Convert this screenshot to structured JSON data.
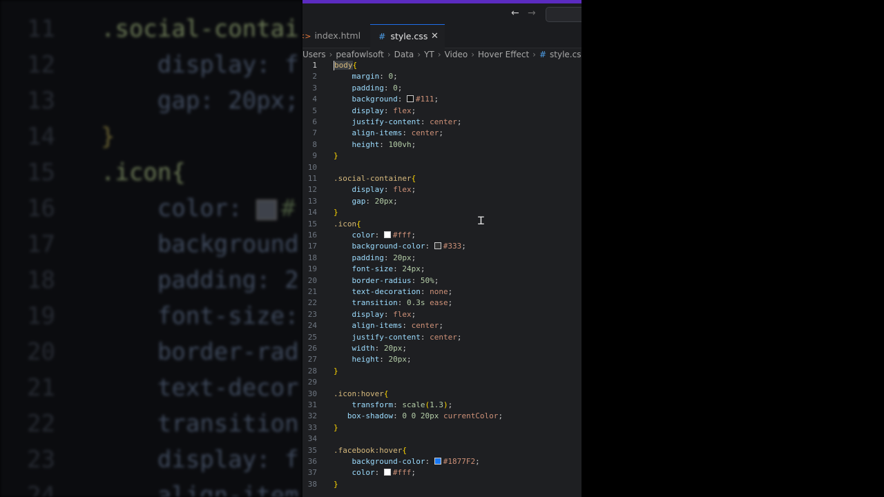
{
  "background": {
    "lines": [
      {
        "num": "11",
        "parts": [
          {
            "t": ".social-contai",
            "c": "bg-sel"
          }
        ]
      },
      {
        "num": "12",
        "parts": [
          {
            "t": "    display: f",
            "c": "bg-prop"
          }
        ]
      },
      {
        "num": "13",
        "parts": [
          {
            "t": "    gap: 20px;",
            "c": "bg-prop"
          }
        ]
      },
      {
        "num": "14",
        "parts": [
          {
            "t": "}",
            "c": "bg-brace"
          }
        ]
      },
      {
        "num": "15",
        "parts": [
          {
            "t": ".icon{",
            "c": "bg-sel"
          }
        ]
      },
      {
        "num": "16",
        "parts": [
          {
            "t": "    color: ",
            "c": "bg-prop"
          },
          {
            "t": "SWATCH",
            "c": ""
          },
          {
            "t": "#",
            "c": "bg-val"
          }
        ]
      },
      {
        "num": "17",
        "parts": [
          {
            "t": "    background-",
            "c": "bg-prop"
          }
        ]
      },
      {
        "num": "18",
        "parts": [
          {
            "t": "    padding: 2",
            "c": "bg-prop"
          }
        ]
      },
      {
        "num": "19",
        "parts": [
          {
            "t": "    font-size:",
            "c": "bg-prop"
          }
        ]
      },
      {
        "num": "20",
        "parts": [
          {
            "t": "    border-rad",
            "c": "bg-prop"
          }
        ]
      },
      {
        "num": "21",
        "parts": [
          {
            "t": "    text-decor",
            "c": "bg-prop"
          }
        ]
      },
      {
        "num": "22",
        "parts": [
          {
            "t": "    transition",
            "c": "bg-prop"
          }
        ]
      },
      {
        "num": "23",
        "parts": [
          {
            "t": "    display: f",
            "c": "bg-prop"
          }
        ]
      },
      {
        "num": "24",
        "parts": [
          {
            "t": "    align-item",
            "c": "bg-prop"
          }
        ]
      }
    ]
  },
  "tabs": {
    "index": {
      "label": "index.html",
      "icon": "<>"
    },
    "style": {
      "label": "style.css",
      "icon": "#",
      "close": "✕"
    }
  },
  "nav": {
    "back": "←",
    "forward": "→"
  },
  "breadcrumb": [
    "Users",
    "peafowlsoft",
    "Data",
    "YT",
    "Video",
    "Hover Effect",
    "style.css"
  ],
  "breadcrumb_sep": "›",
  "code": [
    {
      "n": "1",
      "t": [
        [
          "body",
          "sel hl"
        ],
        [
          "{",
          "br"
        ]
      ]
    },
    {
      "n": "2",
      "t": [
        [
          "    margin",
          "prop"
        ],
        [
          ": ",
          "pun"
        ],
        [
          "0",
          "num"
        ],
        [
          ";",
          "pun"
        ]
      ]
    },
    {
      "n": "3",
      "t": [
        [
          "    padding",
          "prop"
        ],
        [
          ": ",
          "pun"
        ],
        [
          "0",
          "num"
        ],
        [
          ";",
          "pun"
        ]
      ]
    },
    {
      "n": "4",
      "t": [
        [
          "    background",
          "prop"
        ],
        [
          ": ",
          "pun"
        ],
        [
          "",
          "sw:#111111"
        ],
        [
          "#111",
          "str"
        ],
        [
          ";",
          "pun"
        ]
      ]
    },
    {
      "n": "5",
      "t": [
        [
          "    display",
          "prop"
        ],
        [
          ": ",
          "pun"
        ],
        [
          "flex",
          "str"
        ],
        [
          ";",
          "pun"
        ]
      ]
    },
    {
      "n": "6",
      "t": [
        [
          "    justify-content",
          "prop"
        ],
        [
          ": ",
          "pun"
        ],
        [
          "center",
          "str"
        ],
        [
          ";",
          "pun"
        ]
      ]
    },
    {
      "n": "7",
      "t": [
        [
          "    align-items",
          "prop"
        ],
        [
          ": ",
          "pun"
        ],
        [
          "center",
          "str"
        ],
        [
          ";",
          "pun"
        ]
      ]
    },
    {
      "n": "8",
      "t": [
        [
          "    height",
          "prop"
        ],
        [
          ": ",
          "pun"
        ],
        [
          "100vh",
          "num"
        ],
        [
          ";",
          "pun"
        ]
      ]
    },
    {
      "n": "9",
      "t": [
        [
          "}",
          "br"
        ]
      ]
    },
    {
      "n": "10",
      "t": []
    },
    {
      "n": "11",
      "t": [
        [
          ".social-container",
          "sel"
        ],
        [
          "{",
          "br"
        ]
      ]
    },
    {
      "n": "12",
      "t": [
        [
          "    display",
          "prop"
        ],
        [
          ": ",
          "pun"
        ],
        [
          "flex",
          "str"
        ],
        [
          ";",
          "pun"
        ]
      ]
    },
    {
      "n": "13",
      "t": [
        [
          "    gap",
          "prop"
        ],
        [
          ": ",
          "pun"
        ],
        [
          "20px",
          "num"
        ],
        [
          ";",
          "pun"
        ]
      ]
    },
    {
      "n": "14",
      "t": [
        [
          "}",
          "br"
        ]
      ]
    },
    {
      "n": "15",
      "t": [
        [
          ".icon",
          "sel"
        ],
        [
          "{",
          "br"
        ]
      ]
    },
    {
      "n": "16",
      "t": [
        [
          "    color",
          "prop"
        ],
        [
          ": ",
          "pun"
        ],
        [
          "",
          "sw:#ffffff"
        ],
        [
          "#fff",
          "str"
        ],
        [
          ";",
          "pun"
        ]
      ]
    },
    {
      "n": "17",
      "t": [
        [
          "    background-color",
          "prop"
        ],
        [
          ": ",
          "pun"
        ],
        [
          "",
          "sw:#333333"
        ],
        [
          "#333",
          "str"
        ],
        [
          ";",
          "pun"
        ]
      ]
    },
    {
      "n": "18",
      "t": [
        [
          "    padding",
          "prop"
        ],
        [
          ": ",
          "pun"
        ],
        [
          "20px",
          "num"
        ],
        [
          ";",
          "pun"
        ]
      ]
    },
    {
      "n": "19",
      "t": [
        [
          "    font-size",
          "prop"
        ],
        [
          ": ",
          "pun"
        ],
        [
          "24px",
          "num"
        ],
        [
          ";",
          "pun"
        ]
      ]
    },
    {
      "n": "20",
      "t": [
        [
          "    border-radius",
          "prop"
        ],
        [
          ": ",
          "pun"
        ],
        [
          "50%",
          "num"
        ],
        [
          ";",
          "pun"
        ]
      ]
    },
    {
      "n": "21",
      "t": [
        [
          "    text-decoration",
          "prop"
        ],
        [
          ": ",
          "pun"
        ],
        [
          "none",
          "str"
        ],
        [
          ";",
          "pun"
        ]
      ]
    },
    {
      "n": "22",
      "t": [
        [
          "    transition",
          "prop"
        ],
        [
          ": ",
          "pun"
        ],
        [
          "0.3s",
          "num"
        ],
        [
          " ",
          "pun"
        ],
        [
          "ease",
          "str"
        ],
        [
          ";",
          "pun"
        ]
      ]
    },
    {
      "n": "23",
      "t": [
        [
          "    display",
          "prop"
        ],
        [
          ": ",
          "pun"
        ],
        [
          "flex",
          "str"
        ],
        [
          ";",
          "pun"
        ]
      ]
    },
    {
      "n": "24",
      "t": [
        [
          "    align-items",
          "prop"
        ],
        [
          ": ",
          "pun"
        ],
        [
          "center",
          "str"
        ],
        [
          ";",
          "pun"
        ]
      ]
    },
    {
      "n": "25",
      "t": [
        [
          "    justify-content",
          "prop"
        ],
        [
          ": ",
          "pun"
        ],
        [
          "center",
          "str"
        ],
        [
          ";",
          "pun"
        ]
      ]
    },
    {
      "n": "26",
      "t": [
        [
          "    width",
          "prop"
        ],
        [
          ": ",
          "pun"
        ],
        [
          "20px",
          "num"
        ],
        [
          ";",
          "pun"
        ]
      ]
    },
    {
      "n": "27",
      "t": [
        [
          "    height",
          "prop"
        ],
        [
          ": ",
          "pun"
        ],
        [
          "20px",
          "num"
        ],
        [
          ";",
          "pun"
        ]
      ]
    },
    {
      "n": "28",
      "t": [
        [
          "}",
          "br"
        ]
      ]
    },
    {
      "n": "29",
      "t": []
    },
    {
      "n": "30",
      "t": [
        [
          ".icon:hover",
          "sel"
        ],
        [
          "{",
          "br"
        ]
      ]
    },
    {
      "n": "31",
      "t": [
        [
          "    transform",
          "prop"
        ],
        [
          ": ",
          "pun"
        ],
        [
          "scale",
          "num"
        ],
        [
          "(",
          "br"
        ],
        [
          "1.3",
          "num"
        ],
        [
          ")",
          "br"
        ],
        [
          ";",
          "pun"
        ]
      ]
    },
    {
      "n": "32",
      "t": [
        [
          "   box-shadow",
          "prop"
        ],
        [
          ": ",
          "pun"
        ],
        [
          "0 0 20px",
          "num"
        ],
        [
          " ",
          "pun"
        ],
        [
          "currentColor",
          "str"
        ],
        [
          ";",
          "pun"
        ]
      ]
    },
    {
      "n": "33",
      "t": [
        [
          "}",
          "br"
        ]
      ]
    },
    {
      "n": "34",
      "t": []
    },
    {
      "n": "35",
      "t": [
        [
          ".facebook:hover",
          "sel"
        ],
        [
          "{",
          "br"
        ]
      ]
    },
    {
      "n": "36",
      "t": [
        [
          "    background-color",
          "prop"
        ],
        [
          ": ",
          "pun"
        ],
        [
          "",
          "sw:#1877F2"
        ],
        [
          "#1877F2",
          "str"
        ],
        [
          ";",
          "pun"
        ]
      ]
    },
    {
      "n": "37",
      "t": [
        [
          "    color",
          "prop"
        ],
        [
          ": ",
          "pun"
        ],
        [
          "",
          "sw:#ffffff"
        ],
        [
          "#fff",
          "str"
        ],
        [
          ";",
          "pun"
        ]
      ]
    },
    {
      "n": "38",
      "t": [
        [
          "}",
          "br"
        ]
      ]
    }
  ],
  "colors": {
    "accent": "#5b2bc0",
    "editor_bg": "#1e1f22",
    "tab_active_border": "#1f6feb"
  }
}
